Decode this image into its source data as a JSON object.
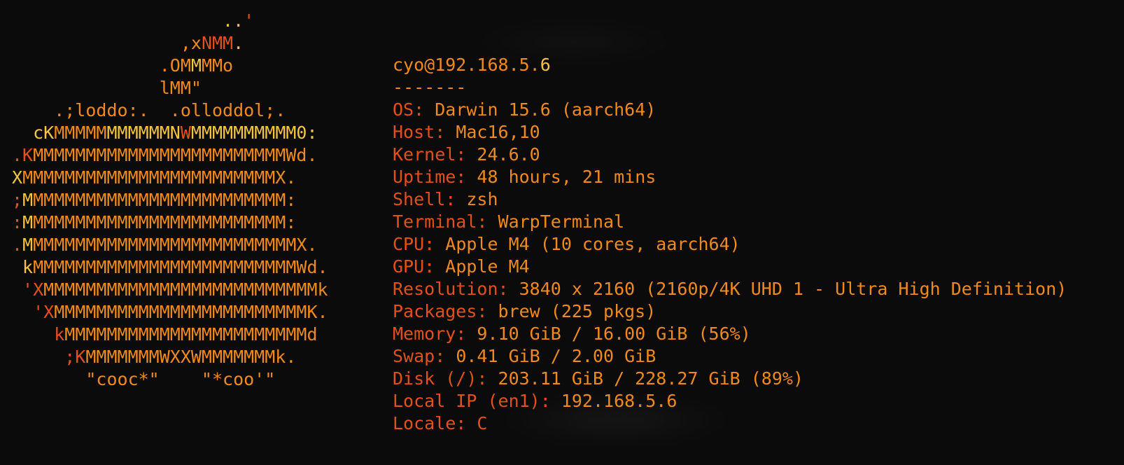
{
  "logo": [
    [
      [
        "                    ..",
        "y"
      ],
      [
        "'",
        "r"
      ]
    ],
    [
      [
        "                ,x",
        "o"
      ],
      [
        "NMM",
        "r"
      ],
      [
        ".",
        "y"
      ]
    ],
    [
      [
        "              .OM",
        "o"
      ],
      [
        "M",
        "y"
      ],
      [
        "MMo",
        "o"
      ]
    ],
    [
      [
        "              lMM\"",
        "o"
      ]
    ],
    [
      [
        "    .;loddo:.  .olloddol;.",
        "o"
      ]
    ],
    [
      [
        "  cK",
        "y"
      ],
      [
        "MMMMM",
        "o"
      ],
      [
        "MMMMMMN",
        "y"
      ],
      [
        "W",
        "r"
      ],
      [
        "MMMMMMMMMM0:",
        "y"
      ]
    ],
    [
      [
        ".K",
        "r"
      ],
      [
        "MMMMMMMMMMMMMMMMMMMMMMMMWd.",
        "o"
      ]
    ],
    [
      [
        "X",
        "y"
      ],
      [
        "MMMMMMMMMMMMMMMMMMMMMMMMX.",
        "o"
      ]
    ],
    [
      [
        ";",
        "r"
      ],
      [
        "M",
        "y"
      ],
      [
        "MMMMMMMMMMMMMMMMMMMMMMMM:",
        "o"
      ]
    ],
    [
      [
        ":",
        "r"
      ],
      [
        "M",
        "y"
      ],
      [
        "MMMMMMMMMMMMMMMMMMMMMMMM:",
        "o"
      ]
    ],
    [
      [
        ".",
        "r"
      ],
      [
        "M",
        "y"
      ],
      [
        "MMMMMMMMMMMMMMMMMMMMMMMMMX.",
        "o"
      ]
    ],
    [
      [
        " k",
        "y"
      ],
      [
        "MMMMMMMMMMMMMMMMMMMMMMMMMWd.",
        "o"
      ]
    ],
    [
      [
        " 'X",
        "r"
      ],
      [
        "MMMMMMMMMMMMMMMMMMMMMMMMMMk",
        "o"
      ]
    ],
    [
      [
        "  'X",
        "r"
      ],
      [
        "MMMMMMMMMMMMMMMMMMMMMMMMK.",
        "o"
      ]
    ],
    [
      [
        "    k",
        "r"
      ],
      [
        "MMMMMMMMMMMMMMMMMMMMMMMd",
        "o"
      ]
    ],
    [
      [
        "     ;K",
        "r"
      ],
      [
        "MMMMMMMWXXWMMMMMMMk.",
        "o"
      ]
    ],
    [
      [
        "       \"cooc*\"    \"*coo'\"",
        "o"
      ]
    ]
  ],
  "info": [
    [
      [
        "cyo@192.168.5.",
        "o"
      ],
      [
        "6",
        "y"
      ]
    ],
    [
      [
        "-------",
        "o"
      ]
    ],
    [
      [
        "OS: ",
        "r"
      ],
      [
        "Darwin 15.6 (aarch64)",
        "o"
      ]
    ],
    [
      [
        "Host: ",
        "r"
      ],
      [
        "Mac16,10",
        "o"
      ]
    ],
    [
      [
        "Kernel: ",
        "r"
      ],
      [
        "24.6.0",
        "o"
      ]
    ],
    [
      [
        "Uptime: ",
        "r"
      ],
      [
        "48 hours, 21 mins",
        "o"
      ]
    ],
    [
      [
        "Shell: ",
        "r"
      ],
      [
        "zsh",
        "o"
      ]
    ],
    [
      [
        "Terminal: ",
        "r"
      ],
      [
        "WarpTerminal",
        "o"
      ]
    ],
    [
      [
        "CPU: ",
        "r"
      ],
      [
        "Apple M4 (10 cores, aarch64)",
        "o"
      ]
    ],
    [
      [
        "GPU: ",
        "r"
      ],
      [
        "Apple M4",
        "o"
      ]
    ],
    [
      [
        "Resolution: ",
        "r"
      ],
      [
        "3840 x 2160 (2160p/4K UHD 1 - Ultra High Definition)",
        "o"
      ]
    ],
    [
      [
        "Packages: ",
        "r"
      ],
      [
        "brew (225 pkgs)",
        "o"
      ]
    ],
    [
      [
        "Memory: ",
        "r"
      ],
      [
        "9.10 GiB / 16.00 GiB (56%)",
        "o"
      ]
    ],
    [
      [
        "Swap: ",
        "r"
      ],
      [
        "0.41 GiB / 2.00 GiB",
        "o"
      ]
    ],
    [
      [
        "Disk (/): ",
        "r"
      ],
      [
        "203.11 GiB / 228.27 GiB (89%)",
        "o"
      ]
    ],
    [
      [
        "Local IP (en1): ",
        "r"
      ],
      [
        "192.168.5.6",
        "o"
      ]
    ],
    [
      [
        "Locale: ",
        "r"
      ],
      [
        "C",
        "r"
      ]
    ]
  ],
  "colors": {
    "background": "#0b0b0b",
    "yellow": "#f5c542",
    "orange": "#f08a1e",
    "red": "#e2501c"
  }
}
